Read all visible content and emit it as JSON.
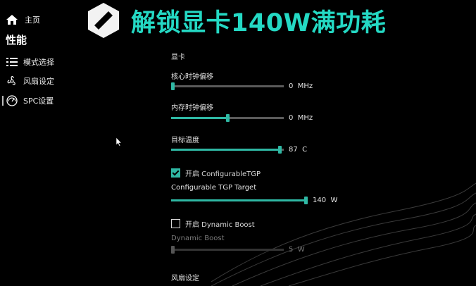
{
  "banner": {
    "text": "解锁显卡140W满功耗"
  },
  "nav": {
    "home": {
      "label": "主页",
      "icon": "home-icon"
    },
    "title": "性能",
    "items": [
      {
        "label": "模式选择",
        "icon": "list-icon"
      },
      {
        "label": "风扇设定",
        "icon": "fan-icon"
      },
      {
        "label": "SPC设置",
        "icon": "gauge-icon"
      }
    ]
  },
  "panel": {
    "section_gpu": "显卡",
    "core_clock": {
      "label": "核心时钟偏移",
      "value": "0",
      "unit": "MHz",
      "fraction": 0.0
    },
    "mem_clock": {
      "label": "内存时钟偏移",
      "value": "0",
      "unit": "MHz",
      "fraction": 0.5
    },
    "target_temp": {
      "label": "目标温度",
      "value": "87",
      "unit": "C",
      "fraction": 0.98
    },
    "ctgp_toggle": {
      "label": "开启 ConfigurableTGP",
      "checked": true
    },
    "ctgp_target": {
      "label": "Configurable TGP Target",
      "value": "140",
      "unit": "W",
      "fraction": 1.0
    },
    "dynamic_boost_toggle": {
      "label": "开启 Dynamic Boost",
      "checked": false
    },
    "dynamic_boost": {
      "label": "Dynamic Boost",
      "value": "5",
      "unit": "W",
      "fraction": 0.0
    },
    "section_fan": "风扇设定"
  },
  "colors": {
    "accent": "#2fb8a4",
    "banner": "#24d9c4",
    "background": "#000000"
  }
}
